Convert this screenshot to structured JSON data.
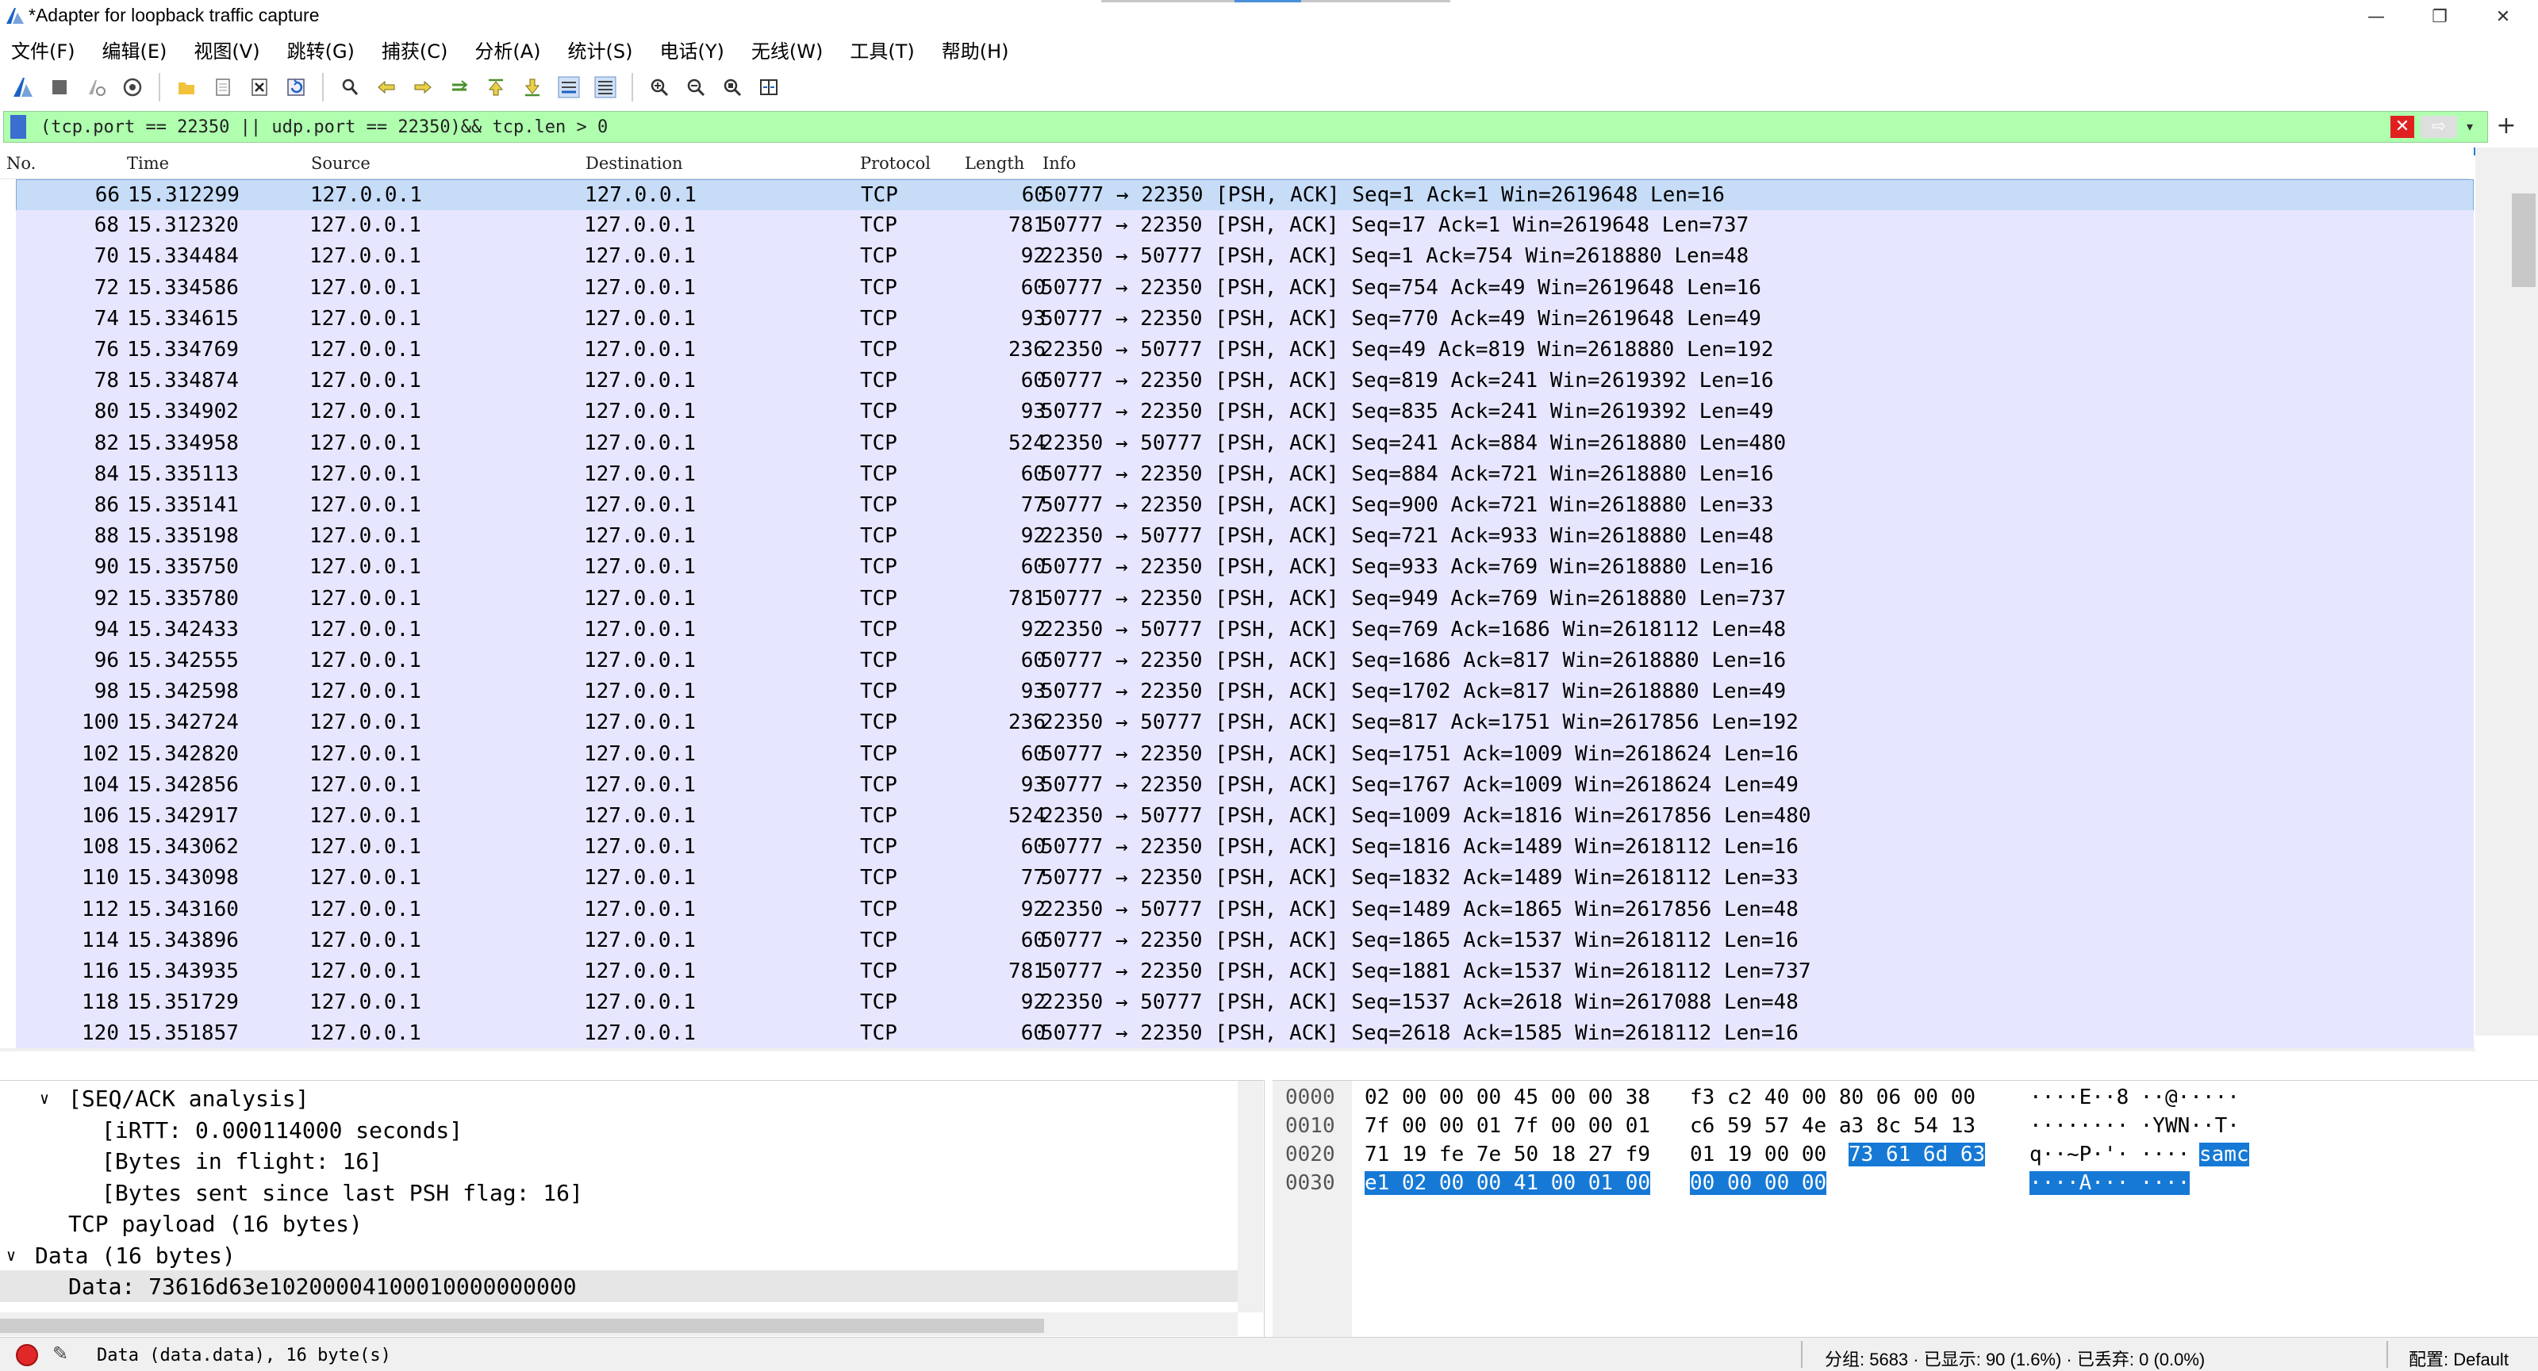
{
  "window": {
    "title": "*Adapter for loopback traffic capture",
    "minimize": "—",
    "restore": "❐",
    "close": "✕"
  },
  "menu": [
    "文件(F)",
    "编辑(E)",
    "视图(V)",
    "跳转(G)",
    "捕获(C)",
    "分析(A)",
    "统计(S)",
    "电话(Y)",
    "无线(W)",
    "工具(T)",
    "帮助(H)"
  ],
  "toolbar_icons": [
    "shark-fin-start-icon",
    "stop-icon",
    "restart-icon",
    "options-icon",
    "open-folder-icon",
    "file-icon",
    "close-file-icon",
    "reload-icon",
    "find-icon",
    "back-icon",
    "forward-icon",
    "go-to-icon",
    "first-icon",
    "last-icon",
    "autoscroll-icon",
    "colorize-icon",
    "zoom-in-icon",
    "zoom-out-icon",
    "zoom-reset-icon",
    "resize-columns-icon"
  ],
  "filter": {
    "text": "(tcp.port == 22350 || udp.port == 22350)&& tcp.len > 0",
    "bg_color": "#afffaf"
  },
  "columns": [
    "No.",
    "Time",
    "Source",
    "Destination",
    "Protocol",
    "Length",
    "Info"
  ],
  "packets": [
    {
      "no": "66",
      "time": "15.312299",
      "src": "127.0.0.1",
      "dst": "127.0.0.1",
      "proto": "TCP",
      "len": "60",
      "info": "50777 → 22350 [PSH, ACK] Seq=1 Ack=1 Win=2619648 Len=16"
    },
    {
      "no": "68",
      "time": "15.312320",
      "src": "127.0.0.1",
      "dst": "127.0.0.1",
      "proto": "TCP",
      "len": "781",
      "info": "50777 → 22350 [PSH, ACK] Seq=17 Ack=1 Win=2619648 Len=737"
    },
    {
      "no": "70",
      "time": "15.334484",
      "src": "127.0.0.1",
      "dst": "127.0.0.1",
      "proto": "TCP",
      "len": "92",
      "info": "22350 → 50777 [PSH, ACK] Seq=1 Ack=754 Win=2618880 Len=48"
    },
    {
      "no": "72",
      "time": "15.334586",
      "src": "127.0.0.1",
      "dst": "127.0.0.1",
      "proto": "TCP",
      "len": "60",
      "info": "50777 → 22350 [PSH, ACK] Seq=754 Ack=49 Win=2619648 Len=16"
    },
    {
      "no": "74",
      "time": "15.334615",
      "src": "127.0.0.1",
      "dst": "127.0.0.1",
      "proto": "TCP",
      "len": "93",
      "info": "50777 → 22350 [PSH, ACK] Seq=770 Ack=49 Win=2619648 Len=49"
    },
    {
      "no": "76",
      "time": "15.334769",
      "src": "127.0.0.1",
      "dst": "127.0.0.1",
      "proto": "TCP",
      "len": "236",
      "info": "22350 → 50777 [PSH, ACK] Seq=49 Ack=819 Win=2618880 Len=192"
    },
    {
      "no": "78",
      "time": "15.334874",
      "src": "127.0.0.1",
      "dst": "127.0.0.1",
      "proto": "TCP",
      "len": "60",
      "info": "50777 → 22350 [PSH, ACK] Seq=819 Ack=241 Win=2619392 Len=16"
    },
    {
      "no": "80",
      "time": "15.334902",
      "src": "127.0.0.1",
      "dst": "127.0.0.1",
      "proto": "TCP",
      "len": "93",
      "info": "50777 → 22350 [PSH, ACK] Seq=835 Ack=241 Win=2619392 Len=49"
    },
    {
      "no": "82",
      "time": "15.334958",
      "src": "127.0.0.1",
      "dst": "127.0.0.1",
      "proto": "TCP",
      "len": "524",
      "info": "22350 → 50777 [PSH, ACK] Seq=241 Ack=884 Win=2618880 Len=480"
    },
    {
      "no": "84",
      "time": "15.335113",
      "src": "127.0.0.1",
      "dst": "127.0.0.1",
      "proto": "TCP",
      "len": "60",
      "info": "50777 → 22350 [PSH, ACK] Seq=884 Ack=721 Win=2618880 Len=16"
    },
    {
      "no": "86",
      "time": "15.335141",
      "src": "127.0.0.1",
      "dst": "127.0.0.1",
      "proto": "TCP",
      "len": "77",
      "info": "50777 → 22350 [PSH, ACK] Seq=900 Ack=721 Win=2618880 Len=33"
    },
    {
      "no": "88",
      "time": "15.335198",
      "src": "127.0.0.1",
      "dst": "127.0.0.1",
      "proto": "TCP",
      "len": "92",
      "info": "22350 → 50777 [PSH, ACK] Seq=721 Ack=933 Win=2618880 Len=48"
    },
    {
      "no": "90",
      "time": "15.335750",
      "src": "127.0.0.1",
      "dst": "127.0.0.1",
      "proto": "TCP",
      "len": "60",
      "info": "50777 → 22350 [PSH, ACK] Seq=933 Ack=769 Win=2618880 Len=16"
    },
    {
      "no": "92",
      "time": "15.335780",
      "src": "127.0.0.1",
      "dst": "127.0.0.1",
      "proto": "TCP",
      "len": "781",
      "info": "50777 → 22350 [PSH, ACK] Seq=949 Ack=769 Win=2618880 Len=737"
    },
    {
      "no": "94",
      "time": "15.342433",
      "src": "127.0.0.1",
      "dst": "127.0.0.1",
      "proto": "TCP",
      "len": "92",
      "info": "22350 → 50777 [PSH, ACK] Seq=769 Ack=1686 Win=2618112 Len=48"
    },
    {
      "no": "96",
      "time": "15.342555",
      "src": "127.0.0.1",
      "dst": "127.0.0.1",
      "proto": "TCP",
      "len": "60",
      "info": "50777 → 22350 [PSH, ACK] Seq=1686 Ack=817 Win=2618880 Len=16"
    },
    {
      "no": "98",
      "time": "15.342598",
      "src": "127.0.0.1",
      "dst": "127.0.0.1",
      "proto": "TCP",
      "len": "93",
      "info": "50777 → 22350 [PSH, ACK] Seq=1702 Ack=817 Win=2618880 Len=49"
    },
    {
      "no": "100",
      "time": "15.342724",
      "src": "127.0.0.1",
      "dst": "127.0.0.1",
      "proto": "TCP",
      "len": "236",
      "info": "22350 → 50777 [PSH, ACK] Seq=817 Ack=1751 Win=2617856 Len=192"
    },
    {
      "no": "102",
      "time": "15.342820",
      "src": "127.0.0.1",
      "dst": "127.0.0.1",
      "proto": "TCP",
      "len": "60",
      "info": "50777 → 22350 [PSH, ACK] Seq=1751 Ack=1009 Win=2618624 Len=16"
    },
    {
      "no": "104",
      "time": "15.342856",
      "src": "127.0.0.1",
      "dst": "127.0.0.1",
      "proto": "TCP",
      "len": "93",
      "info": "50777 → 22350 [PSH, ACK] Seq=1767 Ack=1009 Win=2618624 Len=49"
    },
    {
      "no": "106",
      "time": "15.342917",
      "src": "127.0.0.1",
      "dst": "127.0.0.1",
      "proto": "TCP",
      "len": "524",
      "info": "22350 → 50777 [PSH, ACK] Seq=1009 Ack=1816 Win=2617856 Len=480"
    },
    {
      "no": "108",
      "time": "15.343062",
      "src": "127.0.0.1",
      "dst": "127.0.0.1",
      "proto": "TCP",
      "len": "60",
      "info": "50777 → 22350 [PSH, ACK] Seq=1816 Ack=1489 Win=2618112 Len=16"
    },
    {
      "no": "110",
      "time": "15.343098",
      "src": "127.0.0.1",
      "dst": "127.0.0.1",
      "proto": "TCP",
      "len": "77",
      "info": "50777 → 22350 [PSH, ACK] Seq=1832 Ack=1489 Win=2618112 Len=33"
    },
    {
      "no": "112",
      "time": "15.343160",
      "src": "127.0.0.1",
      "dst": "127.0.0.1",
      "proto": "TCP",
      "len": "92",
      "info": "22350 → 50777 [PSH, ACK] Seq=1489 Ack=1865 Win=2617856 Len=48"
    },
    {
      "no": "114",
      "time": "15.343896",
      "src": "127.0.0.1",
      "dst": "127.0.0.1",
      "proto": "TCP",
      "len": "60",
      "info": "50777 → 22350 [PSH, ACK] Seq=1865 Ack=1537 Win=2618112 Len=16"
    },
    {
      "no": "116",
      "time": "15.343935",
      "src": "127.0.0.1",
      "dst": "127.0.0.1",
      "proto": "TCP",
      "len": "781",
      "info": "50777 → 22350 [PSH, ACK] Seq=1881 Ack=1537 Win=2618112 Len=737"
    },
    {
      "no": "118",
      "time": "15.351729",
      "src": "127.0.0.1",
      "dst": "127.0.0.1",
      "proto": "TCP",
      "len": "92",
      "info": "22350 → 50777 [PSH, ACK] Seq=1537 Ack=2618 Win=2617088 Len=48"
    },
    {
      "no": "120",
      "time": "15.351857",
      "src": "127.0.0.1",
      "dst": "127.0.0.1",
      "proto": "TCP",
      "len": "60",
      "info": "50777 → 22350 [PSH, ACK] Seq=2618 Ack=1585 Win=2618112 Len=16"
    }
  ],
  "selected_packet_index": 0,
  "details": [
    {
      "indent": 1,
      "toggle": "∨",
      "text": "[SEQ/ACK analysis]",
      "selected": false
    },
    {
      "indent": 2,
      "toggle": "",
      "text": "[iRTT: 0.000114000 seconds]",
      "selected": false
    },
    {
      "indent": 2,
      "toggle": "",
      "text": "[Bytes in flight: 16]",
      "selected": false
    },
    {
      "indent": 2,
      "toggle": "",
      "text": "[Bytes sent since last PSH flag: 16]",
      "selected": false
    },
    {
      "indent": 1,
      "toggle": "",
      "text": "TCP payload (16 bytes)",
      "selected": false
    },
    {
      "indent": 0,
      "toggle": "∨",
      "text": "Data (16 bytes)",
      "selected": false
    },
    {
      "indent": 1,
      "toggle": "",
      "text": "Data: 73616d63e10200004100010000000000",
      "selected": true
    }
  ],
  "bytes": [
    {
      "offset": "0000",
      "hex1": "02 00 00 00 45 00 00 38",
      "hex2": "f3 c2 40 00 80 06 00 00",
      "hex2_hl": "",
      "ascii1": "····E··8",
      "ascii2": " ··@·····",
      "ascii_hl": "",
      "hl_full": false
    },
    {
      "offset": "0010",
      "hex1": "7f 00 00 01 7f 00 00 01",
      "hex2": "c6 59 57 4e a3 8c 54 13",
      "hex2_hl": "",
      "ascii1": "········",
      "ascii2": " ·YWN··T·",
      "ascii_hl": "",
      "hl_full": false
    },
    {
      "offset": "0020",
      "hex1": "71 19 fe 7e 50 18 27 f9",
      "hex2": "01 19 00 00 ",
      "hex2_hl": "73 61 6d 63",
      "ascii1": "q··~P·'·",
      "ascii2": " ····",
      "ascii_hl": "samc",
      "hl_full": false
    },
    {
      "offset": "0030",
      "hex1": "e1 02 00 00 41 00 01 00",
      "hex2": "00 00 00 00",
      "hex2_hl": "",
      "ascii1": "····A···",
      "ascii2": " ····",
      "ascii_hl": "",
      "hl_full": true
    }
  ],
  "status": {
    "field": "Data (data.data), 16 byte(s)",
    "stats": "分组: 5683 · 已显示: 90 (1.6%) · 已丢弃: 0 (0.0%)",
    "profile": "配置: Default",
    "stop_color": "#e02828"
  },
  "colors": {
    "row_bg": "#e7e6ff",
    "selected_row": "#c6dcf7",
    "byte_highlight": "#1679d6"
  }
}
